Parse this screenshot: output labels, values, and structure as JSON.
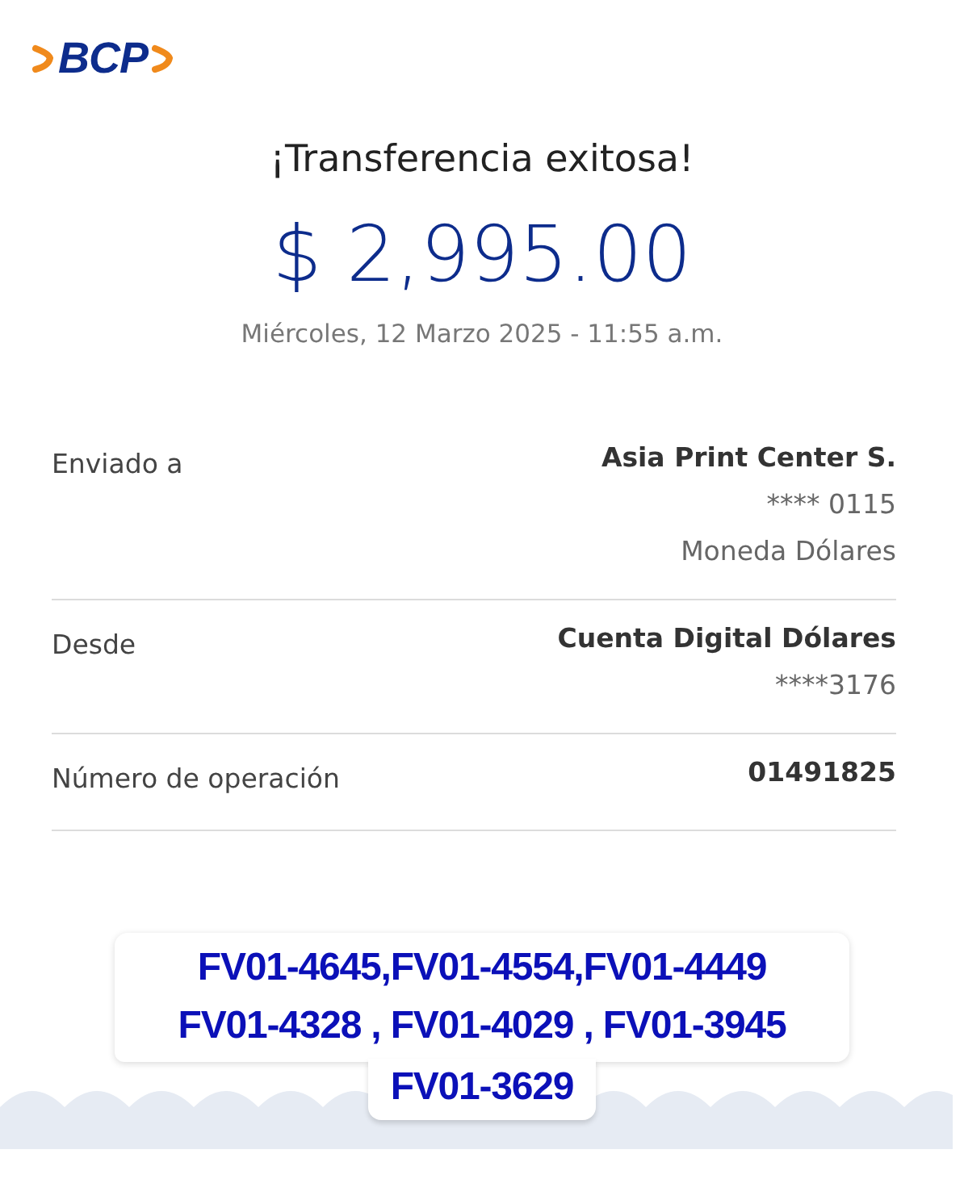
{
  "logo": {
    "text": "BCP"
  },
  "title": "¡Transferencia exitosa!",
  "amount": "$ 2,995.00",
  "date": "Miércoles, 12 Marzo 2025 - 11:55 a.m.",
  "details": [
    {
      "label": "Enviado a",
      "values": [
        "Asia Print Center S.",
        "**** 0115",
        "Moneda Dólares"
      ]
    },
    {
      "label": "Desde",
      "values": [
        "Cuenta Digital Dólares",
        "****3176"
      ]
    },
    {
      "label": "Número de operación",
      "values": [
        "01491825"
      ]
    }
  ],
  "annotation_lines": [
    "FV01-4645,FV01-4554,FV01-4449",
    "FV01-4328 , FV01-4029 , FV01-3945",
    "FV01-3629"
  ]
}
